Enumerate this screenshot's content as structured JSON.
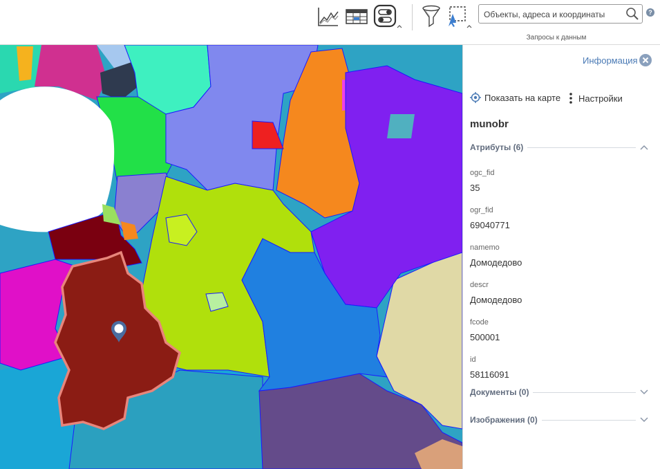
{
  "toolbar": {
    "search_placeholder": "Объекты, адреса и координаты",
    "caption": "Запросы к данным",
    "help_symbol": "?",
    "icons": [
      "chart-icon",
      "table-icon",
      "layers-toggle-icon",
      "filter-icon",
      "select-area-icon",
      "search-icon",
      "help-icon"
    ]
  },
  "panel": {
    "title": "Информация",
    "show_on_map": "Показать на карте",
    "settings": "Настройки",
    "object_name": "munobr",
    "attributes_header": "Атрибуты (6)",
    "attributes": [
      {
        "name": "ogc_fid",
        "value": "35"
      },
      {
        "name": "ogr_fid",
        "value": "69040771"
      },
      {
        "name": "namemo",
        "value": "Домодедово"
      },
      {
        "name": "descr",
        "value": "Домодедово"
      },
      {
        "name": "fcode",
        "value": "500001"
      },
      {
        "name": "id",
        "value": "58116091"
      }
    ],
    "documents_header": "Документы (0)",
    "images_header": "Изображения (0)"
  },
  "colors": {
    "accent": "#4a7ab5",
    "selected_region": "#8b1c14",
    "selection_outline": "#e8857b"
  }
}
